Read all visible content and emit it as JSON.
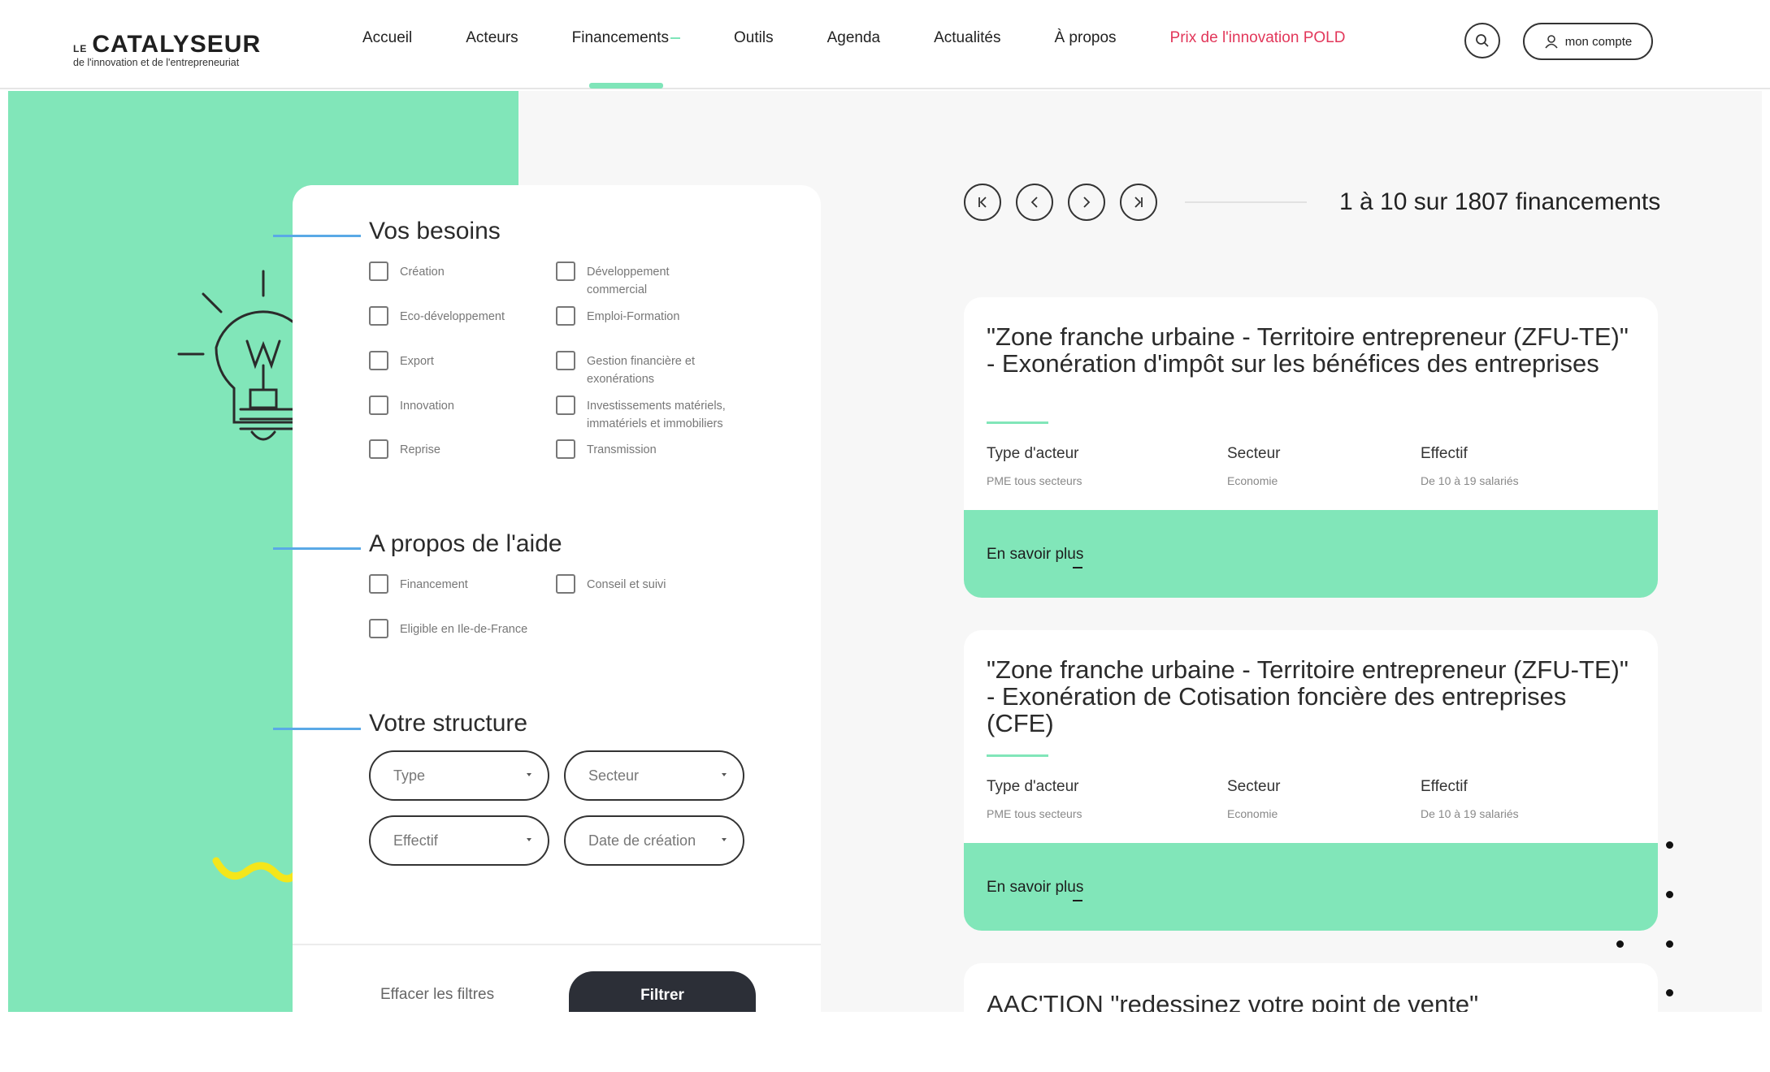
{
  "logo": {
    "prefix": "LE",
    "brand": "CATALYSEUR",
    "tagline": "de l'innovation et de l'entrepreneuriat"
  },
  "nav": {
    "items": [
      {
        "label": "Accueil"
      },
      {
        "label": "Acteurs"
      },
      {
        "label": "Financements"
      },
      {
        "label": "Outils"
      },
      {
        "label": "Agenda"
      },
      {
        "label": "Actualités"
      },
      {
        "label": "À propos"
      },
      {
        "label": "Prix de l'innovation POLD"
      }
    ],
    "active_index": 2,
    "highlight_color": "#e2375a"
  },
  "header_actions": {
    "search_icon": "search-icon",
    "account_label": "mon compte",
    "account_icon": "user-icon"
  },
  "filters": {
    "needs": {
      "title": "Vos besoins",
      "options": [
        "Création",
        "Développement commercial",
        "Eco-développement",
        "Emploi-Formation",
        "Export",
        "Gestion financière et exonérations",
        "Innovation",
        "Investissements matériels, immatériels et immobiliers",
        "Reprise",
        "Transmission"
      ]
    },
    "aid": {
      "title": "A propos de l'aide",
      "options": [
        "Financement",
        "Conseil et suivi",
        "Eligible en Ile-de-France"
      ]
    },
    "structure": {
      "title": "Votre structure",
      "selects": [
        "Type",
        "Secteur",
        "Effectif",
        "Date de création"
      ]
    },
    "clear_label": "Effacer les filtres",
    "submit_label": "Filtrer"
  },
  "pagination": {
    "summary": "1 à 10 sur 1807 financements"
  },
  "results": {
    "labels": {
      "actor_type": "Type d'acteur",
      "sector": "Secteur",
      "headcount": "Effectif",
      "more": "En savoir plus"
    },
    "cards": [
      {
        "title": "\"Zone franche urbaine - Territoire entrepreneur (ZFU-TE)\" - Exonération d'impôt sur les bénéfices des entreprises",
        "actor_type": "PME tous secteurs",
        "sector": "Economie",
        "headcount": "De 10 à 19 salariés"
      },
      {
        "title": "\"Zone franche urbaine - Territoire entrepreneur (ZFU-TE)\" - Exonération de Cotisation foncière des entreprises (CFE)",
        "actor_type": "PME tous secteurs",
        "sector": "Economie",
        "headcount": "De 10 à 19 salariés"
      },
      {
        "title": "AAC'TION \"redessinez votre point de vente\""
      }
    ]
  },
  "colors": {
    "accent_green": "#81e6b9",
    "section_line_blue": "#5aa9e6",
    "dark_button": "#2c2f37"
  }
}
